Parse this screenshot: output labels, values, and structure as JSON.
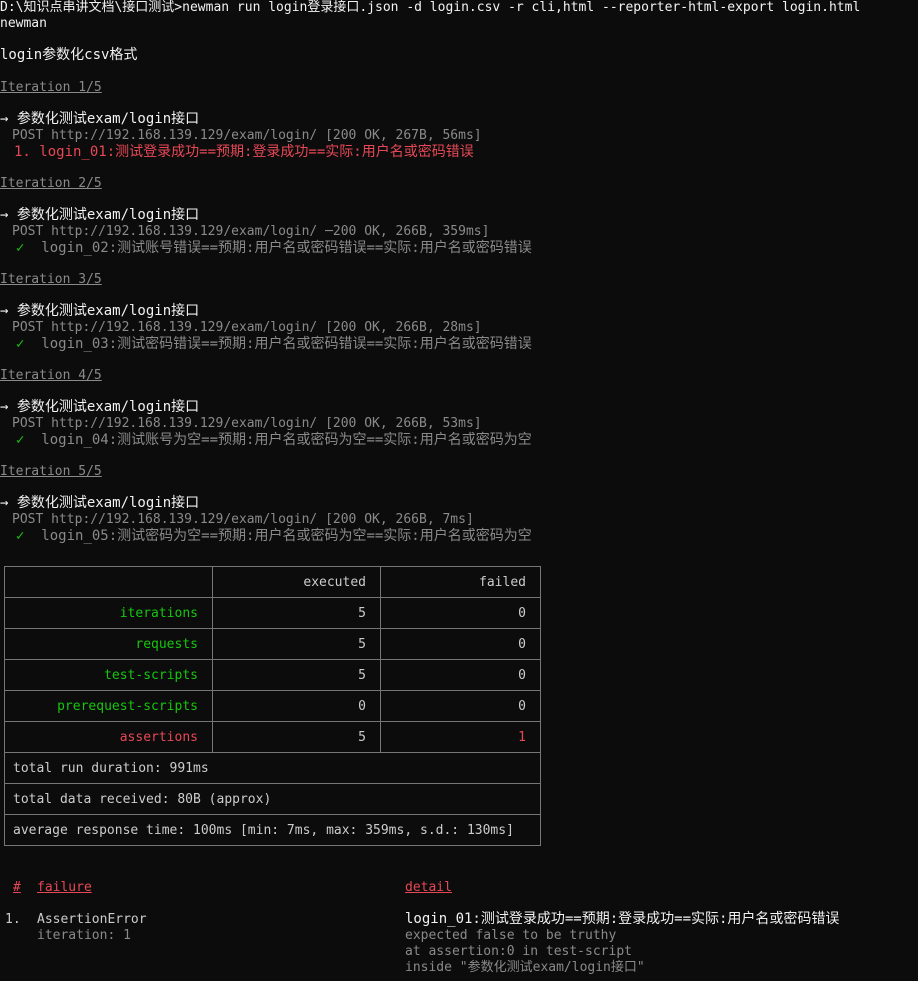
{
  "command": "D:\\知识点串讲文档\\接口测试>newman run login登录接口.json -d login.csv -r cli,html --reporter-html-export login.html",
  "app": "newman",
  "collection": "login参数化csv格式",
  "request_name": "参数化测试exam/login接口",
  "iterations": [
    {
      "label": "Iteration 1/5",
      "request": "POST http://192.168.139.129/exam/login/ [200 OK, 267B, 56ms]",
      "assertion": "1. login_01:测试登录成功==预期:登录成功==实际:用户名或密码错误",
      "passed": false
    },
    {
      "label": "Iteration 2/5",
      "request": "POST http://192.168.139.129/exam/login/ ─200 OK, 266B, 359ms]",
      "assertion": "login_02:测试账号错误==预期:用户名或密码错误==实际:用户名或密码错误",
      "passed": true
    },
    {
      "label": "Iteration 3/5",
      "request": "POST http://192.168.139.129/exam/login/ [200 OK, 266B, 28ms]",
      "assertion": "login_03:测试密码错误==预期:用户名或密码错误==实际:用户名或密码错误",
      "passed": true
    },
    {
      "label": "Iteration 4/5",
      "request": "POST http://192.168.139.129/exam/login/ [200 OK, 266B, 53ms]",
      "assertion": "login_04:测试账号为空==预期:用户名或密码为空==实际:用户名或密码为空",
      "passed": true
    },
    {
      "label": "Iteration 5/5",
      "request": "POST http://192.168.139.129/exam/login/ [200 OK, 266B, 7ms]",
      "assertion": "login_05:测试密码为空==预期:用户名或密码为空==实际:用户名或密码为空",
      "passed": true
    }
  ],
  "table": {
    "headers": [
      "",
      "executed",
      "failed"
    ],
    "rows": [
      {
        "label": "iterations",
        "executed": "5",
        "failed": "0"
      },
      {
        "label": "requests",
        "executed": "5",
        "failed": "0"
      },
      {
        "label": "test-scripts",
        "executed": "5",
        "failed": "0"
      },
      {
        "label": "prerequest-scripts",
        "executed": "0",
        "failed": "0"
      },
      {
        "label": "assertions",
        "executed": "5",
        "failed": "1"
      }
    ],
    "total_run_duration": "total run duration: 991ms",
    "total_data_received": "total data received: 80B (approx)",
    "average_response_time": "average response time: 100ms [min: 7ms, max: 359ms, s.d.: 130ms]"
  },
  "failures": {
    "col_num": "#",
    "col_failure": "failure",
    "col_detail": "detail",
    "items": [
      {
        "num": "1.",
        "error": "AssertionError",
        "iteration": "iteration: 1",
        "detail_title": "login_01:测试登录成功==预期:登录成功==实际:用户名或密码错误",
        "detail_lines": [
          "expected false to be truthy",
          "at assertion:0 in test-script",
          "inside \"参数化测试exam/login接口\""
        ]
      }
    ]
  },
  "colors": {
    "background": "#0c0c0c",
    "text": "#cccccc",
    "gray": "#8a8a8a",
    "error": "#e74856",
    "success": "#16c60c"
  }
}
